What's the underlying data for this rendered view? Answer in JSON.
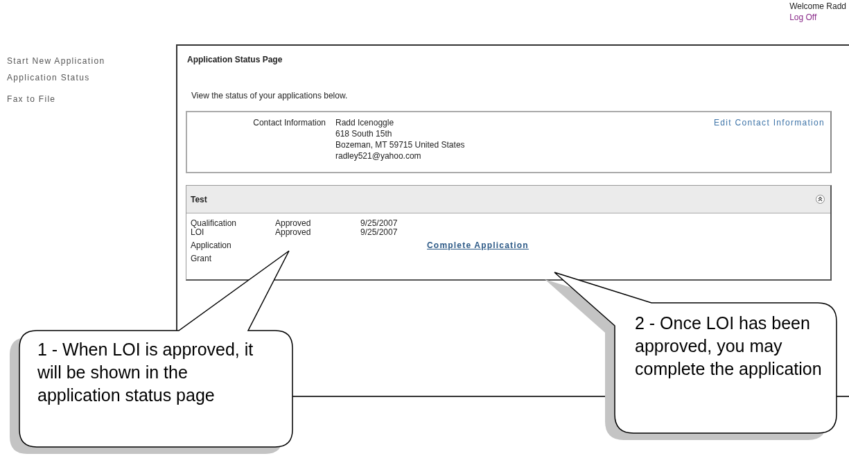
{
  "header": {
    "welcome": "Welcome Radd",
    "logout": "Log Off"
  },
  "nav": [
    {
      "label": "Start New Application"
    },
    {
      "label": "Application Status"
    },
    {
      "label": "Fax to File"
    }
  ],
  "page": {
    "title": "Application Status Page",
    "intro": "View the status of your applications below.",
    "contact": {
      "label": "Contact Information",
      "lines": [
        "Radd Icenoggle",
        "618 South 15th",
        "Bozeman, MT 59715 United States",
        "radley521@yahoo.com"
      ],
      "edit_link": "Edit Contact Information"
    },
    "applications": [
      {
        "name": "Test",
        "expanded": true,
        "stages": [
          {
            "stage": "Qualification",
            "status": "Approved",
            "date": "9/25/2007"
          },
          {
            "stage": "LOI",
            "status": "Approved",
            "date": "9/25/2007"
          },
          {
            "stage": "Application",
            "action": "Complete Application"
          },
          {
            "stage": "Grant"
          }
        ]
      }
    ]
  },
  "callouts": [
    {
      "text": "1 - When LOI is approved, it will be shown in the application status page"
    },
    {
      "text": "2 - Once LOI has been approved, you may complete the application"
    }
  ]
}
